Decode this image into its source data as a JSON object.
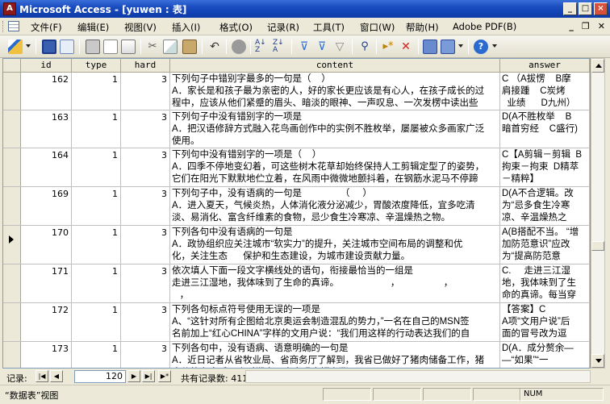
{
  "window": {
    "title": "Microsoft Access - [yuwen : 表]",
    "app_icon": "access-icon"
  },
  "menu": {
    "items": [
      "文件(F)",
      "编辑(E)",
      "视图(V)",
      "插入(I)",
      "格式(O)",
      "记录(R)",
      "工具(T)",
      "窗口(W)",
      "帮助(H)",
      "Adobe PDF(B)"
    ]
  },
  "table": {
    "columns": [
      "id",
      "type",
      "hard",
      "content",
      "answer"
    ],
    "current_row_index": 4,
    "rows": [
      {
        "id": "162",
        "type": "1",
        "hard": "3",
        "content": [
          "下列句子中错别字最多的一句是（    ）",
          "A．家长是和孩子最为亲密的人，好的家长更应该是有心人，在孩子成长的过",
          "程中，应该从他们紧蹙的眉头、暗淡的眼神、一声叹息、一次发楞中读出些"
        ],
        "answer": [
          "C （A拔愣    B摩",
          "肩接踵    C炭烤",
          "  业绩      D九州）"
        ]
      },
      {
        "id": "163",
        "type": "1",
        "hard": "3",
        "content": [
          "下列句子中没有错别字的一项是",
          "A．把汉语修辞方式融入花鸟画创作中的实例不胜枚举，屡屡被众多画家广泛",
          "使用。"
        ],
        "answer": [
          "D(A不胜枚举    B",
          "暗首穷经    C盛行)"
        ]
      },
      {
        "id": "164",
        "type": "1",
        "hard": "3",
        "content": [
          "下列句中没有错别字的一项是（    ）",
          "A．四季不停地变幻着，可这些树木花草却始终保持人工剪辑定型了的姿势，",
          "它们在阳光下默默地伫立着，在风雨中微微地颤抖着，在钢筋水泥马不停蹄"
        ],
        "answer": [
          "C【A剪辑－剪辑  B",
          "拘束－拘束  D精萃",
          "－精粹】"
        ]
      },
      {
        "id": "169",
        "type": "1",
        "hard": "3",
        "content": [
          "下列句子中，没有语病的一句是               （     ）",
          "A．进入夏天，气候炎热，人体消化液分泌减少，胃酸浓度降低，宜多吃清",
          "淡、易消化、富含纤维素的食物，忌少食生冷寒凉、辛温燥热之物。"
        ],
        "answer": [
          "D(A不合逻辑。改",
          "为“忌多食生冷寒",
          "凉、辛温燥热之"
        ]
      },
      {
        "id": "170",
        "type": "1",
        "hard": "3",
        "content": [
          "下列各句中没有语病的一句是",
          "A．政协组织应关注城市“软实力”的提升，关注城市空间布局的调整和优",
          "化，关注生态      保护和生态建设，为城市建设贡献力量。"
        ],
        "answer": [
          "A(B搭配不当。 “增",
          "加防范意识”应改",
          "为“提高防范意"
        ]
      },
      {
        "id": "171",
        "type": "1",
        "hard": "3",
        "content": [
          "依次填人下面一段文字横线处的语句，衔接最恰当的一组是",
          "走进三江湿地，我体味到了生命的真谛。                    ，                 ，",
          "   ，"
        ],
        "answer": [
          "C.     走进三江湿",
          "地，我体味到了生",
          "命的真谛。每当穿"
        ]
      },
      {
        "id": "172",
        "type": "1",
        "hard": "3",
        "content": [
          "下列各句标点符号使用无误的一项是",
          "A、“这针对所有企图给北京奥运会制造混乱的势力，”一名在自己的MSN签",
          "名前加上“红心CHINA”字样的文用户说：“我们用这样的行动表达我们的自"
        ],
        "answer": [
          "【答案】C",
          "A项“文用户说”后",
          "面的冒号改为逗"
        ]
      },
      {
        "id": "173",
        "type": "1",
        "hard": "3",
        "content": [
          "下列各句中，没有语病、语意明确的一句是",
          "A．近日记者从省牧业局、省商务厅了解到，我省已做好了猪肉储备工作，猪",
          "肉价格在今后一个时期内不会出现大幅上涨。"
        ],
        "answer": [
          "D(A．成分赘余—",
          "—“如果”“一"
        ]
      }
    ]
  },
  "navigation": {
    "label": "记录:",
    "current_record": "120",
    "total_label": "共有记录数: 4119"
  },
  "status": {
    "left": "“数据表”视图",
    "num": "NUM"
  }
}
